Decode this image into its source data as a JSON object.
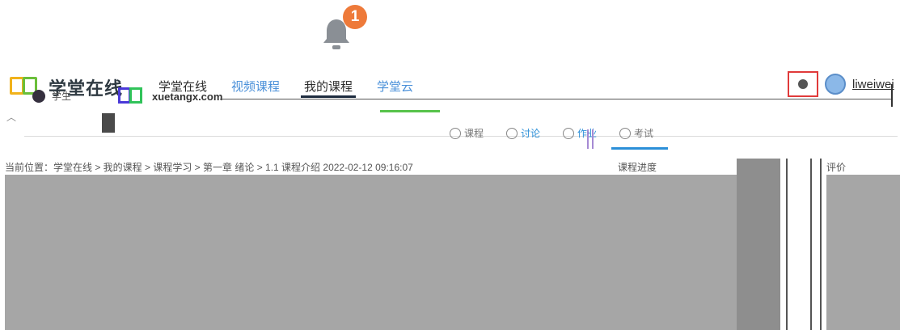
{
  "notification": {
    "count": "1"
  },
  "header": {
    "brand_cn": "学堂在线",
    "role": "学生",
    "domain": "xuetangx.com",
    "nav": [
      {
        "label": "学堂在线"
      },
      {
        "label": "视频课程"
      },
      {
        "label": "我的课程"
      },
      {
        "label": "学堂云"
      }
    ],
    "user": "liweiwei"
  },
  "tabs": [
    {
      "label": "课程"
    },
    {
      "label": "讨论"
    },
    {
      "label": "作业"
    },
    {
      "label": "考试"
    }
  ],
  "info": {
    "line": "当前位置：学堂在线 > 我的课程 > 课程学习 > 第一章 绪论 > 1.1 课程介绍  2022-02-12 09:16:07",
    "right1": "课程进度",
    "right2": "评价"
  }
}
